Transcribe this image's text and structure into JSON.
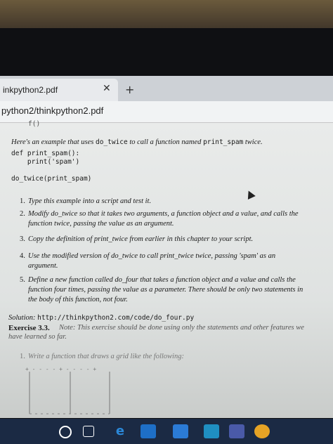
{
  "browser": {
    "tab_title": "inkpython2.pdf",
    "tab_close": "✕",
    "new_tab": "+",
    "address": "python2/thinkpython2.pdf"
  },
  "document": {
    "cut_top_code": "f()",
    "intro_pre": "Here's an example that uses ",
    "intro_code1": "do_twice",
    "intro_mid": " to call a function named ",
    "intro_code2": "print_spam",
    "intro_post": " twice.",
    "code_lines": [
      "def print_spam():",
      "    print('spam')",
      "",
      "do_twice(print_spam)"
    ],
    "items": [
      {
        "number": "1.",
        "lines": [
          "Type this example into a script and test it."
        ]
      },
      {
        "number": "2.",
        "lines": [
          "Modify do_twice so that it takes two arguments, a function object and a value, and calls the",
          "function twice, passing the value as an argument."
        ]
      },
      {
        "number": "3.",
        "lines": [
          "Copy the definition of print_twice from earlier in this chapter to your script."
        ]
      },
      {
        "number": "4.",
        "lines": [
          "Use the modified version of do_twice to call print_twice twice, passing 'spam' as an",
          "argument."
        ]
      },
      {
        "number": "5.",
        "lines": [
          "Define a new function called do_four that takes a function object and a value and calls the",
          "function four times, passing the value as a parameter. There should be only two statements in",
          "the body of this function, not four."
        ]
      }
    ],
    "solution_label": "Solution: ",
    "solution_url": "http://thinkpython2.com/code/do_four.py",
    "exercise_label": "Exercise 3.3.",
    "exercise_note_lines": [
      "Note: This exercise should be done using only the statements and other features we",
      "have learned so far."
    ],
    "sub_item_number": "1.",
    "sub_item_text": "Write a function that draws a grid like the following:",
    "grid_top": "+ - - - - + - - - - +"
  },
  "taskbar": {
    "icons": [
      "search-circle-icon",
      "task-view-icon",
      "edge-icon",
      "store-icon",
      "chrome-icon"
    ]
  }
}
